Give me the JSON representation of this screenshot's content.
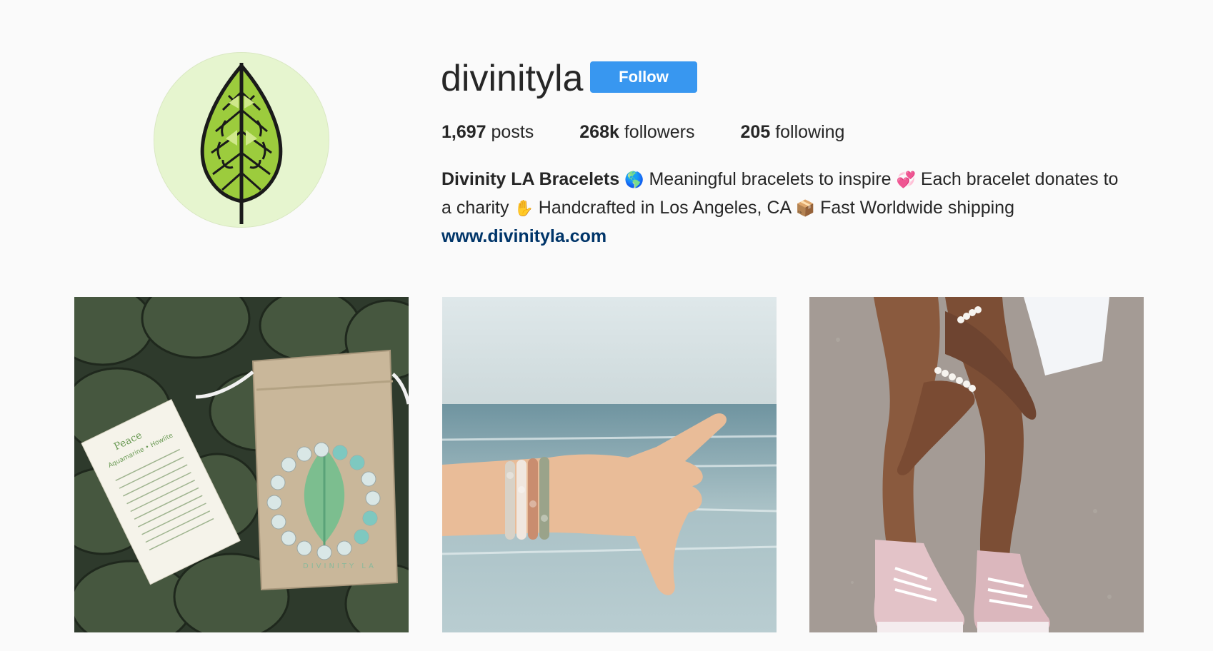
{
  "profile": {
    "username": "divinityla",
    "follow_label": "Follow",
    "stats": {
      "posts_count": "1,697",
      "posts_label": "posts",
      "followers_count": "268k",
      "followers_label": "followers",
      "following_count": "205",
      "following_label": "following"
    },
    "bio": {
      "name": "Divinity LA Bracelets",
      "emoji_globe": "🌎",
      "text_1": " Meaningful bracelets to inspire ",
      "emoji_heart": "💞",
      "text_2": " Each bracelet donates to a charity ",
      "emoji_hand": "✋",
      "text_3": " Handcrafted in Los Angeles, CA ",
      "emoji_box": "📦",
      "text_4": " Fast Worldwide shipping ",
      "link": "www.divinityla.com"
    }
  },
  "posts": [
    {
      "name": "post-bracelet-burlap-bag",
      "card_title": "Peace",
      "card_subtitle": "Aquamarine • Howlite",
      "bag_text": "DIVINITY LA"
    },
    {
      "name": "post-beach-shaka-bracelets"
    },
    {
      "name": "post-legs-pink-sneakers"
    }
  ],
  "colors": {
    "follow_bg": "#3897f0",
    "link": "#003569",
    "avatar_bg": "#e6f5cf",
    "leaf": "#8bc34a"
  }
}
